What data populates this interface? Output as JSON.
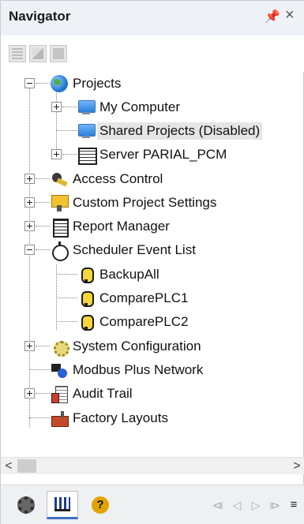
{
  "window": {
    "title": "Navigator",
    "pin_glyph": "↕",
    "close_glyph": "×"
  },
  "toolbar": {
    "buttons": [
      "grid-view-icon",
      "detail-view-icon",
      "fill-view-icon"
    ]
  },
  "tree": {
    "projects": "Projects",
    "my_computer": "My Computer",
    "shared_projects": "Shared Projects (Disabled)",
    "server": "Server PARIAL_PCM",
    "access_control": "Access Control",
    "custom_project_settings": "Custom Project Settings",
    "report_manager": "Report Manager",
    "scheduler_event_list": "Scheduler Event List",
    "backup_all": "BackupAll",
    "compare_plc1": "ComparePLC1",
    "compare_plc2": "ComparePLC2",
    "system_configuration": "System Configuration",
    "modbus_plus_network": "Modbus Plus Network",
    "audit_trail": "Audit Trail",
    "factory_layouts": "Factory Layouts"
  },
  "scrollbar": {
    "left_arrow": "<",
    "right_arrow": ">"
  },
  "tabbar": {
    "tabs": [
      "settings-gear-icon",
      "library-books-icon",
      "help-icon"
    ],
    "active_tab": "library-books-icon",
    "help_glyph": "?",
    "nav": {
      "first": "⧏",
      "prev": "◁",
      "next": "▷",
      "last": "⧐",
      "menu": "≡"
    }
  },
  "colors": {
    "selection": "#e5e5e5",
    "active_tab_accent": "#3c6ec2",
    "titlebar_bg": "#eef1f5"
  }
}
